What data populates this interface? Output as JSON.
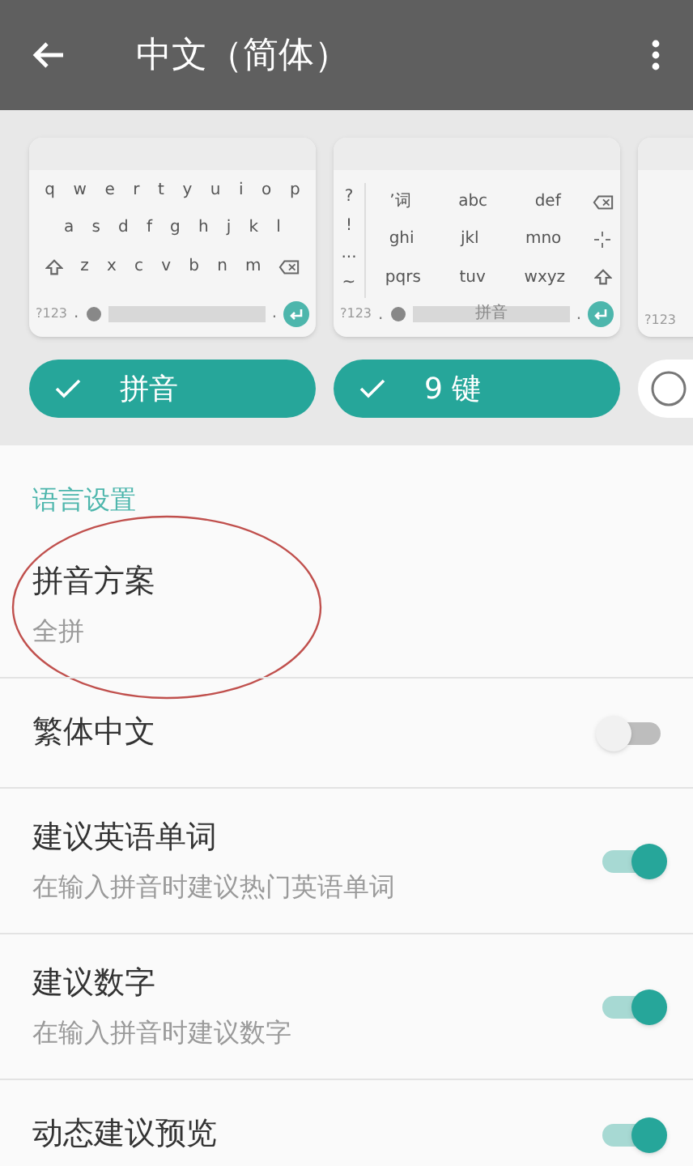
{
  "app_bar": {
    "title": "中文（简体）"
  },
  "layouts": [
    {
      "kind": "qwerty",
      "rows": [
        [
          "q",
          "w",
          "e",
          "r",
          "t",
          "y",
          "u",
          "i",
          "o",
          "p"
        ],
        [
          "a",
          "s",
          "d",
          "f",
          "g",
          "h",
          "j",
          "k",
          "l"
        ],
        [
          "z",
          "x",
          "c",
          "v",
          "b",
          "n",
          "m"
        ]
      ],
      "symbols_key": "?123",
      "period": "."
    },
    {
      "kind": "ninekey",
      "side": [
        "?",
        "!",
        "...",
        "~"
      ],
      "rows": [
        [
          "’词",
          "abc",
          "def"
        ],
        [
          "ghi",
          "jkl",
          "mno"
        ],
        [
          "pqrs",
          "tuv",
          "wxyz"
        ]
      ],
      "symbols_key": "?123",
      "period": ".",
      "space_label": "拼音"
    },
    {
      "kind": "partial",
      "symbols_key": "?123"
    }
  ],
  "chips": [
    {
      "label": "拼音",
      "selected": true
    },
    {
      "label": "9 键",
      "selected": true
    },
    {
      "selected": false
    }
  ],
  "section": "语言设置",
  "annotation": {
    "kind": "ellipse"
  },
  "settings": [
    {
      "kind": "text",
      "title": "拼音方案",
      "summary": "全拼"
    },
    {
      "kind": "switch",
      "title": "繁体中文",
      "on": false
    },
    {
      "kind": "switch",
      "title": "建议英语单词",
      "summary": "在输入拼音时建议热门英语单词",
      "on": true
    },
    {
      "kind": "switch",
      "title": "建议数字",
      "summary": "在输入拼音时建议数字",
      "on": true
    },
    {
      "kind": "switch",
      "title": "动态建议预览",
      "on": true
    }
  ]
}
